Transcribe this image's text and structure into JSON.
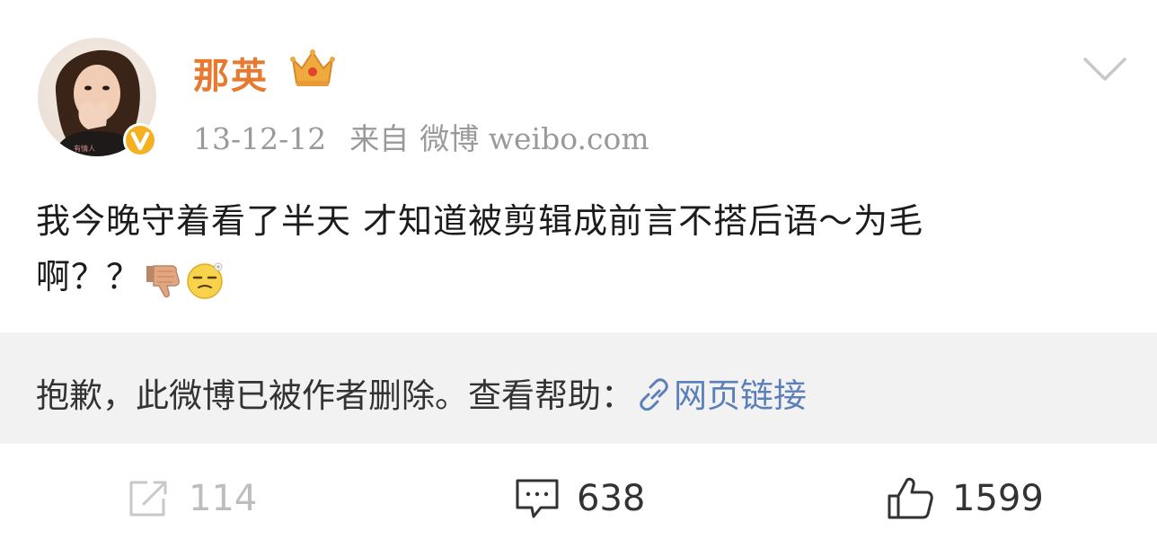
{
  "post": {
    "author": {
      "name": "那英",
      "verified": true,
      "crown_icon": "crown-icon",
      "verified_icon": "verified-v-icon"
    },
    "meta": {
      "date": "13-12-12",
      "from_label": "来自",
      "source": "微博 weibo.com"
    },
    "content": {
      "line1": "我今晚守着看了半天 才知道被剪辑成前言不搭后语～为毛",
      "line2": "啊？？",
      "emojis": [
        "thumbs-down-emoji",
        "dizzy-face-emoji"
      ]
    },
    "repost": {
      "deleted_text": "抱歉，此微博已被作者删除。查看帮助：",
      "link_text": "网页链接",
      "link_icon": "link-icon"
    },
    "actions": {
      "repost_count": "114",
      "comment_count": "638",
      "like_count": "1599"
    },
    "colors": {
      "username": "#e8792f",
      "meta": "#9a9a9a",
      "link": "#5b7fb8",
      "repost_bg": "#f2f2f2",
      "disabled": "#bdbdbd"
    }
  }
}
